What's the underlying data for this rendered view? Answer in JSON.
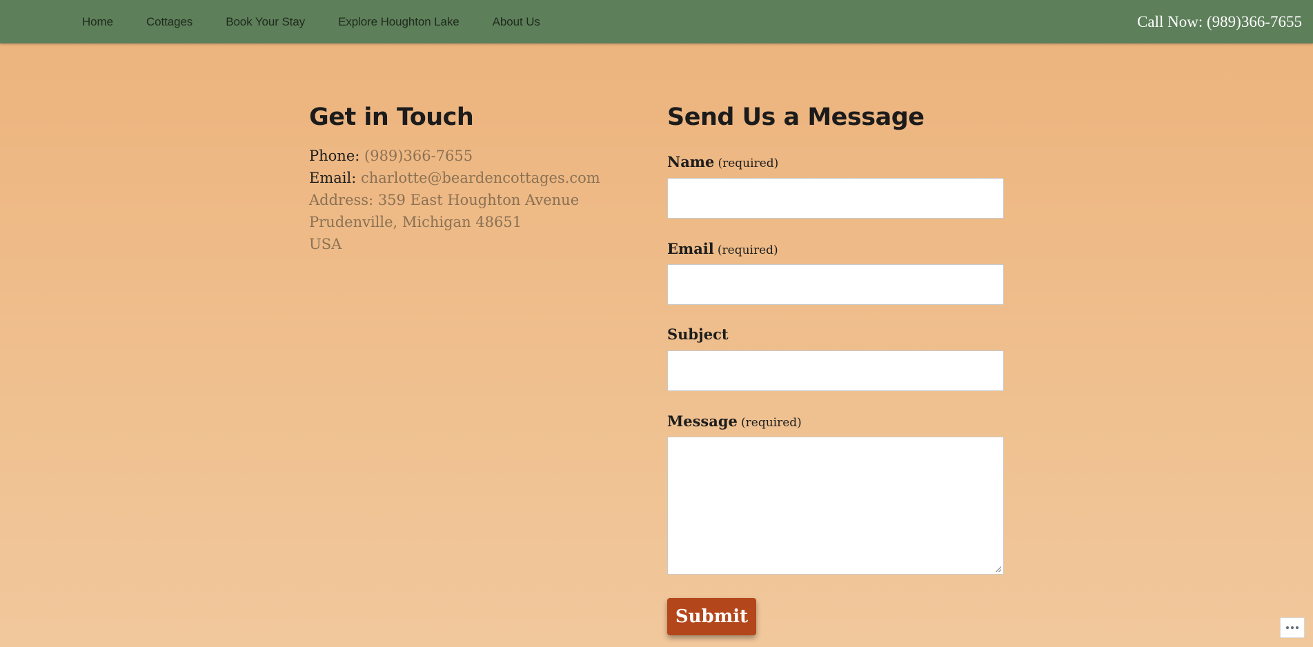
{
  "nav": {
    "items": [
      {
        "label": "Home"
      },
      {
        "label": "Cottages"
      },
      {
        "label": "Book Your Stay"
      },
      {
        "label": "Explore Houghton Lake"
      },
      {
        "label": "About Us"
      }
    ],
    "call_now": "Call Now: (989)366-7655"
  },
  "contact": {
    "title": "Get in Touch",
    "phone_label": "Phone: ",
    "phone": "(989)366-7655",
    "email_label": "Email: ",
    "email": "charlotte@beardencottages.com",
    "address_line1": "Address: 359 East Houghton Avenue",
    "address_line2": "Prudenville, Michigan 48651",
    "address_line3": "USA"
  },
  "form": {
    "title": "Send Us a Message",
    "name_label": "Name",
    "name_required": "(required)",
    "email_label": "Email",
    "email_required": "(required)",
    "subject_label": "Subject",
    "message_label": "Message",
    "message_required": "(required)",
    "submit_label": "Submit"
  },
  "colors": {
    "topbar": "#5d7f5a",
    "submit": "#b3461b",
    "link_muted": "#8a7153"
  },
  "icons": {
    "more": "ellipsis-icon"
  }
}
